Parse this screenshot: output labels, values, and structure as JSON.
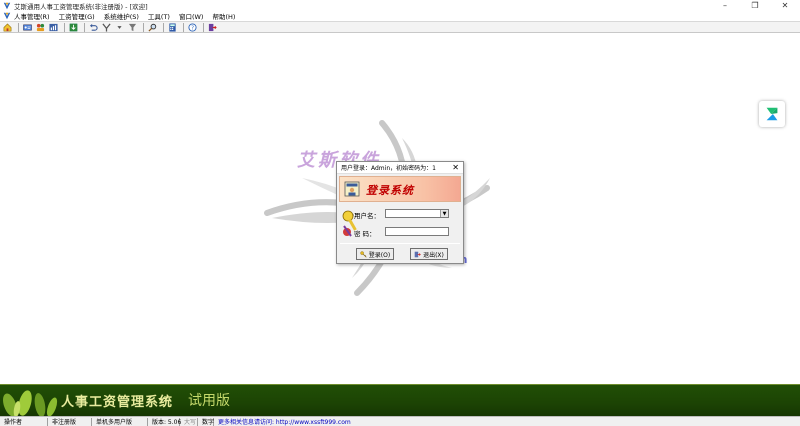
{
  "window": {
    "title": "艾斯通用人事工资管理系统(非注册版) - [欢迎]",
    "minimize_glyph": "–",
    "restore_glyph": "❐",
    "close_glyph": "✕"
  },
  "menu": {
    "items": [
      {
        "label": "人事管理(R)"
      },
      {
        "label": "工资管理(G)"
      },
      {
        "label": "系统维护(S)"
      },
      {
        "label": "工具(T)"
      },
      {
        "label": "窗口(W)"
      },
      {
        "label": "帮助(H)"
      }
    ]
  },
  "toolbar": {
    "icons": [
      "home-icon",
      "id-card-icon",
      "people-icon",
      "report-icon",
      "export-icon",
      "undo-icon",
      "tools-icon",
      "dropdown-icon",
      "filter-icon",
      "search-icon",
      "calculator-icon",
      "help-icon",
      "exit-icon"
    ]
  },
  "background": {
    "brand_text": "艾斯软件",
    "url_fragment": "m"
  },
  "login_dialog": {
    "title": "用户登录：Admin，初始密码为：1",
    "close_glyph": "✕",
    "banner_title": "登录系统",
    "username_label": "用户名：",
    "username_value": "",
    "password_label": "密    码：",
    "password_value": "",
    "login_button": "登录(O)",
    "exit_button": "退出(X)"
  },
  "bottom_banner": {
    "title": "人事工资管理系统",
    "dash": "--",
    "edition": "试用版"
  },
  "statusbar": {
    "operator": "操作者",
    "registration": "非注册版",
    "mode": "单机多用户版",
    "version": "版本: 5.06",
    "caps": "大写",
    "num": "数字",
    "info": "更多相关信息请访问: http://www.xssft999.com"
  },
  "colors": {
    "banner_bg": "#1c4304",
    "banner_text": "#e8eb9d",
    "dialog_title_red": "#c00000",
    "status_link": "#0000c0"
  }
}
